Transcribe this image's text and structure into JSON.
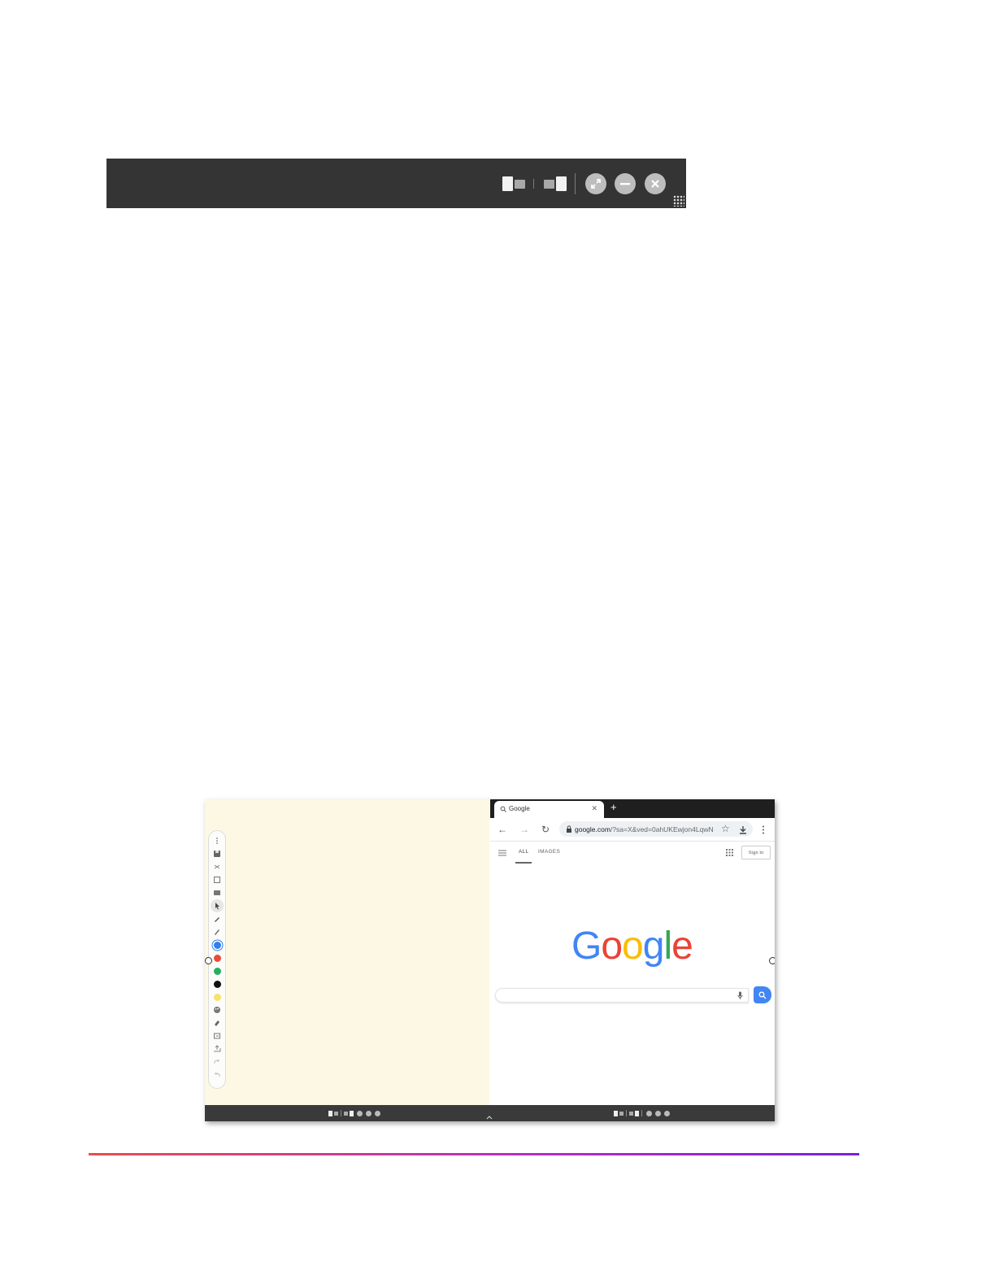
{
  "top_window_bar": {
    "buttons": [
      {
        "name": "split-left-button",
        "icon": "split-screen-left-icon"
      },
      {
        "name": "split-right-button",
        "icon": "split-screen-right-icon"
      },
      {
        "name": "expand-button",
        "icon": "expand-icon"
      },
      {
        "name": "minimize-button",
        "icon": "minimize-icon"
      },
      {
        "name": "close-button",
        "icon": "close-icon"
      }
    ],
    "colors": {
      "bar": "#343434",
      "button": "#bdbdbd",
      "icon_light": "#f2f2f2"
    }
  },
  "split_screen": {
    "whiteboard": {
      "background": "#fdf8e4",
      "toolbar_tools": [
        "more-icon",
        "save-icon",
        "collapse-icon",
        "page-icon",
        "image-icon",
        "select-icon",
        "pen-icon",
        "brush-icon",
        "color-blue",
        "color-red",
        "color-green",
        "color-black",
        "color-yellow",
        "palette-icon",
        "eraser-icon",
        "clear-icon",
        "export-icon",
        "redo-icon",
        "undo-icon"
      ],
      "pen_colors": [
        "#2f80ed",
        "#e74c3c",
        "#27ae60",
        "#111111",
        "#f7e26b"
      ]
    },
    "browser": {
      "tab_title": "Google",
      "new_tab_symbol": "+",
      "url_host": "google.com",
      "url_rest": "/?sa=X&ved=0ahUKEwjon4LqwN",
      "google_nav": {
        "all": "ALL",
        "images": "IMAGES",
        "sign_in": "Sign in"
      },
      "logo": "Google",
      "logo_colors": [
        "#4285f4",
        "#ea4335",
        "#fbbc05",
        "#4285f4",
        "#34a853",
        "#ea4335"
      ]
    }
  }
}
